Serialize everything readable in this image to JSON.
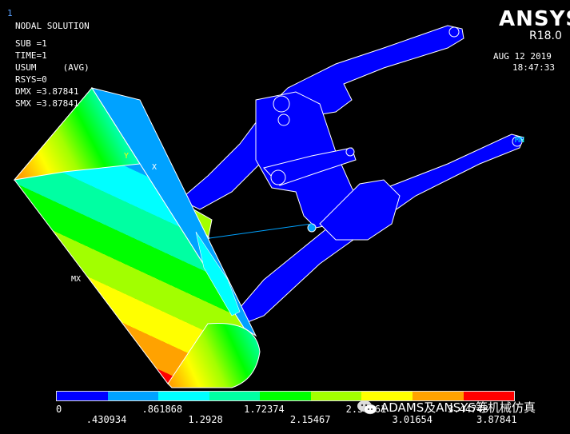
{
  "window": {
    "frame_number": "1"
  },
  "logo": {
    "name": "ANSYS",
    "version": "R18.0"
  },
  "info": {
    "title": "NODAL SOLUTION",
    "lines": [
      "SUB =1",
      "TIME=1",
      "USUM     (AVG)",
      "RSYS=0",
      "DMX =3.87841",
      "SMX =3.87841"
    ]
  },
  "datetime": {
    "date": "AUG 12 2019",
    "time": "18:47:33"
  },
  "model_labels": {
    "max_marker": "MX",
    "min_marker": "MN",
    "triad_x": "X",
    "triad_y": "Y"
  },
  "legend": {
    "colors": [
      "#0000ff",
      "#00a2ff",
      "#00ffff",
      "#00ffa2",
      "#00ff00",
      "#a2ff00",
      "#ffff00",
      "#ffa200",
      "#ff0000"
    ],
    "ticks_top": [
      "0",
      ".861868",
      "1.72374",
      "2.58561",
      "3.44748"
    ],
    "ticks_bottom": [
      ".430934",
      "1.2928",
      "2.15467",
      "3.01654",
      "3.87841"
    ]
  },
  "watermark": {
    "text": "ADAMS及ANSYS等机械仿真",
    "icon": "wechat-icon"
  }
}
